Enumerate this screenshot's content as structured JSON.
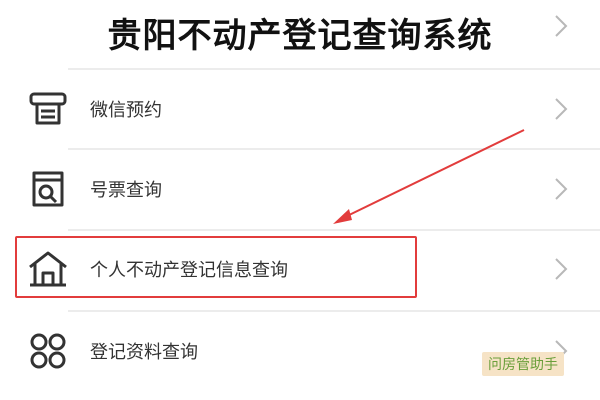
{
  "page": {
    "title": "贵阳不动产登记查询系统"
  },
  "menu": {
    "items": [
      {
        "label": "微信预约",
        "icon": "printer-icon"
      },
      {
        "label": "号票查询",
        "icon": "receipt-search-icon"
      },
      {
        "label": "个人不动产登记信息查询",
        "icon": "house-icon"
      },
      {
        "label": "登记资料查询",
        "icon": "grid-icon"
      }
    ],
    "highlighted_item": "个人不动产登记信息查询"
  },
  "watermark": {
    "text": "问房管助手"
  },
  "colors": {
    "highlight": "#e23c3c",
    "chevron": "#b8b8b8",
    "watermark_bg": "#f6e3c6",
    "watermark_text": "#6a9f3a"
  }
}
